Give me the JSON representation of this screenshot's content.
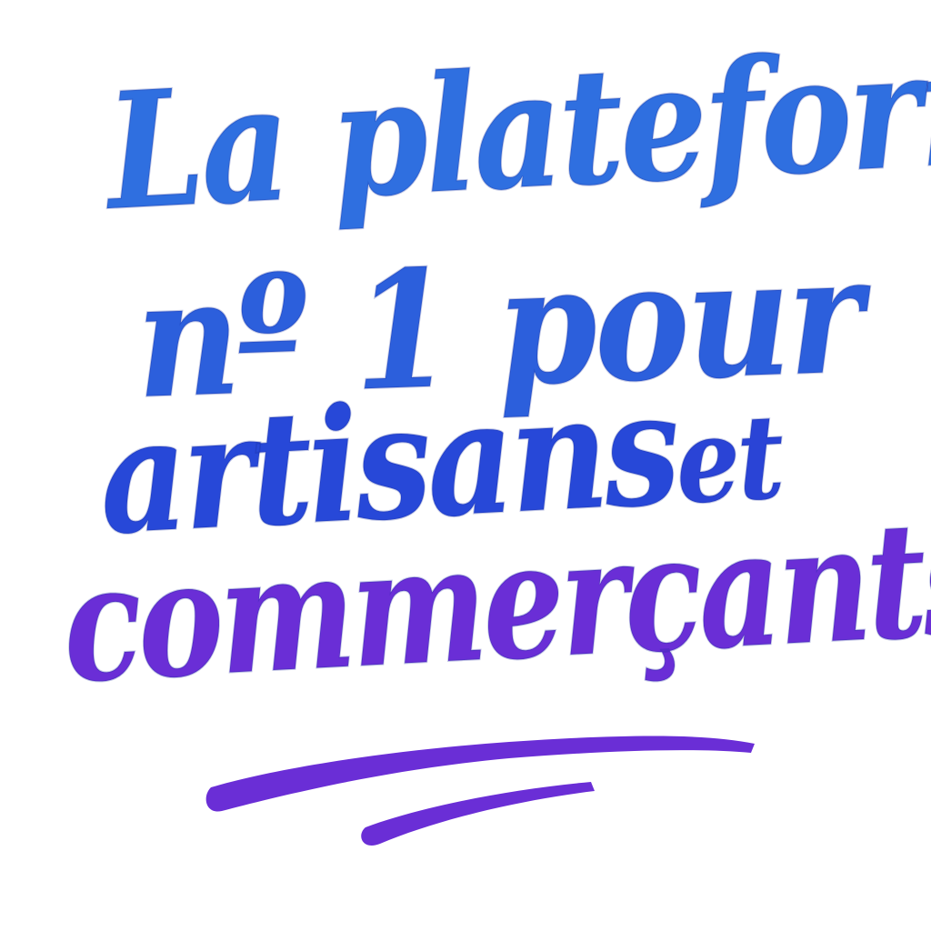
{
  "lettering": {
    "line1": "La plateforme",
    "line2": "nº 1 pour",
    "line3_main": "artisans",
    "line3_small": "et",
    "line4": "commerçants"
  },
  "colors": {
    "blue_light": "#2f6fe0",
    "blue": "#2c5fdc",
    "blue_deep": "#2748d8",
    "violet": "#6a2ed6",
    "swash": "#6a2ed6",
    "background": "#ffffff"
  }
}
